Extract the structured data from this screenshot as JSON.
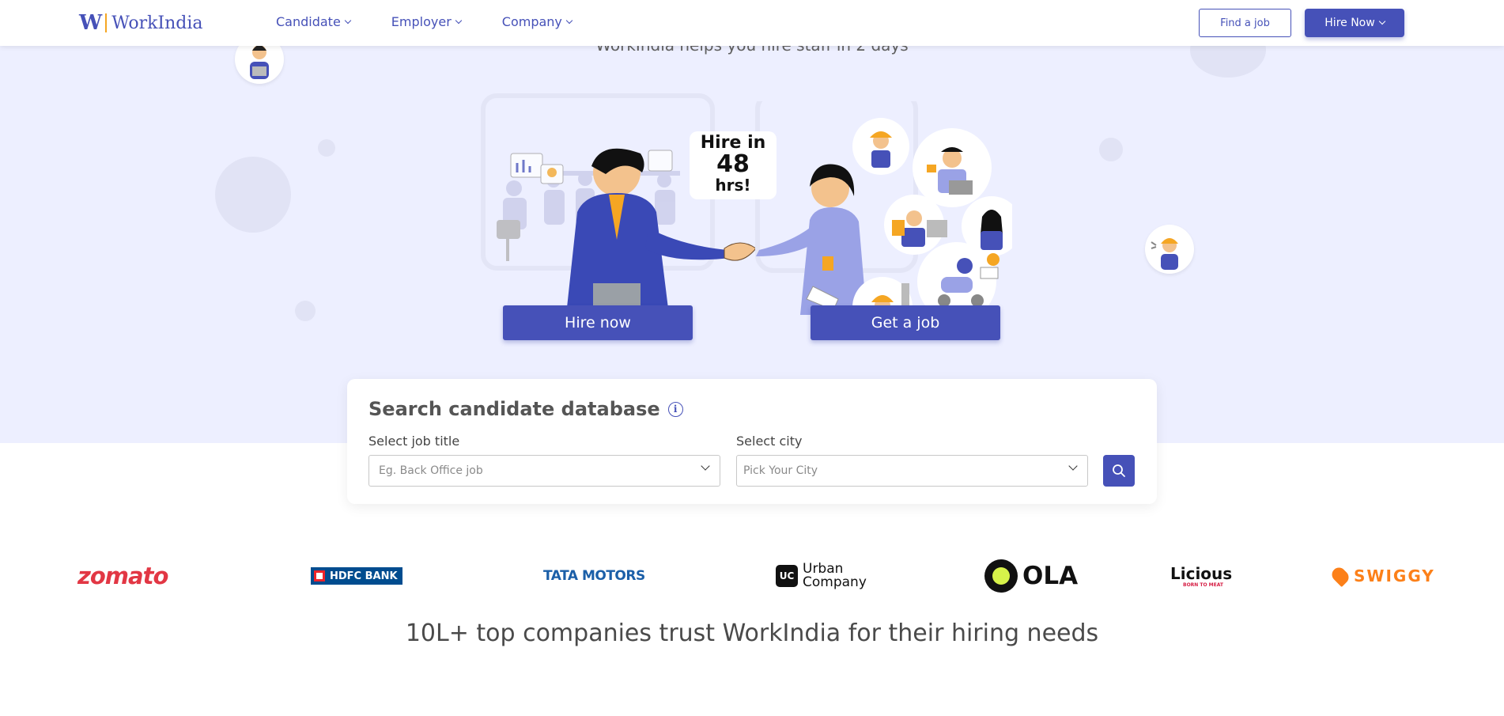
{
  "header": {
    "logo_mark": "W",
    "logo_text": "WorkIndia",
    "nav": [
      {
        "label": "Candidate"
      },
      {
        "label": "Employer"
      },
      {
        "label": "Company"
      }
    ],
    "find_job_label": "Find a job",
    "hire_now_label": "Hire Now"
  },
  "hero": {
    "tagline": "WorkIndia helps you hire staff in 2 days",
    "speech_line1": "Hire in",
    "speech_line2": "48",
    "speech_line3": "hrs!",
    "hire_button_label": "Hire now",
    "job_button_label": "Get a job"
  },
  "search": {
    "title": "Search candidate database",
    "info_icon": "info-icon",
    "job_title_label": "Select job title",
    "job_title_placeholder": "Eg. Back Office job",
    "city_label": "Select city",
    "city_placeholder": "Pick Your City",
    "search_icon": "search-icon"
  },
  "companies": {
    "zomato": "zomato",
    "hdfc": "HDFC BANK",
    "tata": "TATA MOTORS",
    "uc_mark": "UC",
    "uc_line1": "Urban",
    "uc_line2": "Company",
    "ola": "OLA",
    "licious": "Licious",
    "licious_sub": "BORN TO MEAT",
    "swiggy": "SWIGGY"
  },
  "trust_text": "10L+ top companies trust WorkIndia for their hiring needs",
  "colors": {
    "brand": "#4651b8",
    "hero_bg": "#edefff",
    "accent": "#f5a623"
  }
}
